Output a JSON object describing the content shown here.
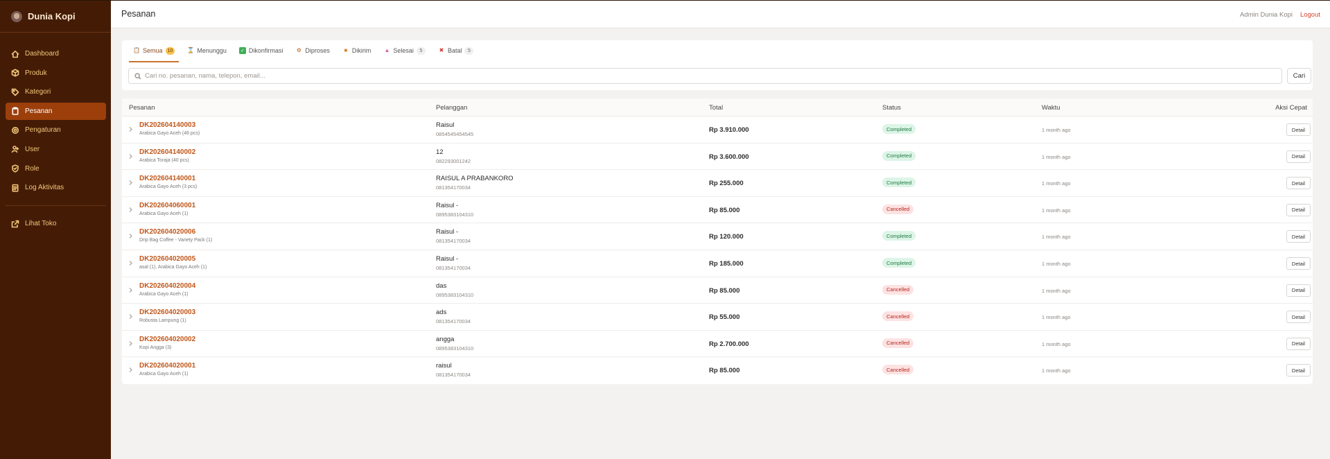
{
  "app": {
    "brand": "Dunia Kopi",
    "accent": "#9c3f0b",
    "sidebar_bg": "#441c06"
  },
  "sidebar": {
    "items": [
      {
        "label": "Dashboard",
        "icon": "home-icon"
      },
      {
        "label": "Produk",
        "icon": "box-icon"
      },
      {
        "label": "Kategori",
        "icon": "tag-icon"
      },
      {
        "label": "Pesanan",
        "icon": "clipboard-icon",
        "active": true
      },
      {
        "label": "Pengaturan",
        "icon": "gear-icon"
      },
      {
        "label": "User",
        "icon": "user-icon"
      },
      {
        "label": "Role",
        "icon": "shield-icon"
      },
      {
        "label": "Log Aktivitas",
        "icon": "log-icon"
      }
    ],
    "external": {
      "label": "Lihat Toko",
      "icon": "external-link-icon"
    }
  },
  "header": {
    "title": "Pesanan",
    "user": "Admin Dunia Kopi",
    "logout": "Logout"
  },
  "tabs": [
    {
      "label": "Semua",
      "count": "10",
      "icon": "document-icon",
      "active": true
    },
    {
      "label": "Menunggu",
      "count": "",
      "icon": "hourglass-icon"
    },
    {
      "label": "Dikonfirmasi",
      "count": "",
      "icon": "check-icon"
    },
    {
      "label": "Diproses",
      "count": "",
      "icon": "gear-icon"
    },
    {
      "label": "Dikirim",
      "count": "",
      "icon": "truck-icon"
    },
    {
      "label": "Selesai",
      "count": "5",
      "icon": "party-icon"
    },
    {
      "label": "Batal",
      "count": "5",
      "icon": "x-icon"
    }
  ],
  "search": {
    "placeholder": "Cari no. pesanan, nama, telepon, email...",
    "value": "",
    "button": "Cari"
  },
  "table": {
    "columns": [
      "Pesanan",
      "Pelanggan",
      "Total",
      "Status",
      "Waktu",
      "Aksi Cepat"
    ],
    "detail_label": "Detail",
    "rows": [
      {
        "id": "DK202604140003",
        "items": "Arabica Gayo Aceh (46 pcs)",
        "customer": "Raisul",
        "phone": "0854545454545",
        "total": "Rp 3.910.000",
        "status": "Completed",
        "time": "1 month ago"
      },
      {
        "id": "DK202604140002",
        "items": "Arabica Toraja (40 pcs)",
        "customer": "12",
        "phone": "082293001242",
        "total": "Rp 3.600.000",
        "status": "Completed",
        "time": "1 month ago"
      },
      {
        "id": "DK202604140001",
        "items": "Arabica Gayo Aceh (3 pcs)",
        "customer": "RAISUL A PRABANKORO",
        "phone": "081354170034",
        "total": "Rp 255.000",
        "status": "Completed",
        "time": "1 month ago"
      },
      {
        "id": "DK202604060001",
        "items": "Arabica Gayo Aceh (1)",
        "customer": "Raisul -",
        "phone": "0895383104310",
        "total": "Rp 85.000",
        "status": "Cancelled",
        "time": "1 month ago"
      },
      {
        "id": "DK202604020006",
        "items": "Drip Bag Coffee - Variety Pack (1)",
        "customer": "Raisul -",
        "phone": "081354170034",
        "total": "Rp 120.000",
        "status": "Completed",
        "time": "1 month ago"
      },
      {
        "id": "DK202604020005",
        "items": "asal (1), Arabica Gayo Aceh (1)",
        "customer": "Raisul -",
        "phone": "081354170034",
        "total": "Rp 185.000",
        "status": "Completed",
        "time": "1 month ago"
      },
      {
        "id": "DK202604020004",
        "items": "Arabica Gayo Aceh (1)",
        "customer": "das",
        "phone": "0895383104310",
        "total": "Rp 85.000",
        "status": "Cancelled",
        "time": "1 month ago"
      },
      {
        "id": "DK202604020003",
        "items": "Robusta Lampung (1)",
        "customer": "ads",
        "phone": "081354170034",
        "total": "Rp 55.000",
        "status": "Cancelled",
        "time": "1 month ago"
      },
      {
        "id": "DK202604020002",
        "items": "Kopi Angga (3)",
        "customer": "angga",
        "phone": "0895383104310",
        "total": "Rp 2.700.000",
        "status": "Cancelled",
        "time": "1 month ago"
      },
      {
        "id": "DK202604020001",
        "items": "Arabica Gayo Aceh (1)",
        "customer": "raisul",
        "phone": "081354170034",
        "total": "Rp 85.000",
        "status": "Cancelled",
        "time": "1 month ago"
      }
    ]
  }
}
